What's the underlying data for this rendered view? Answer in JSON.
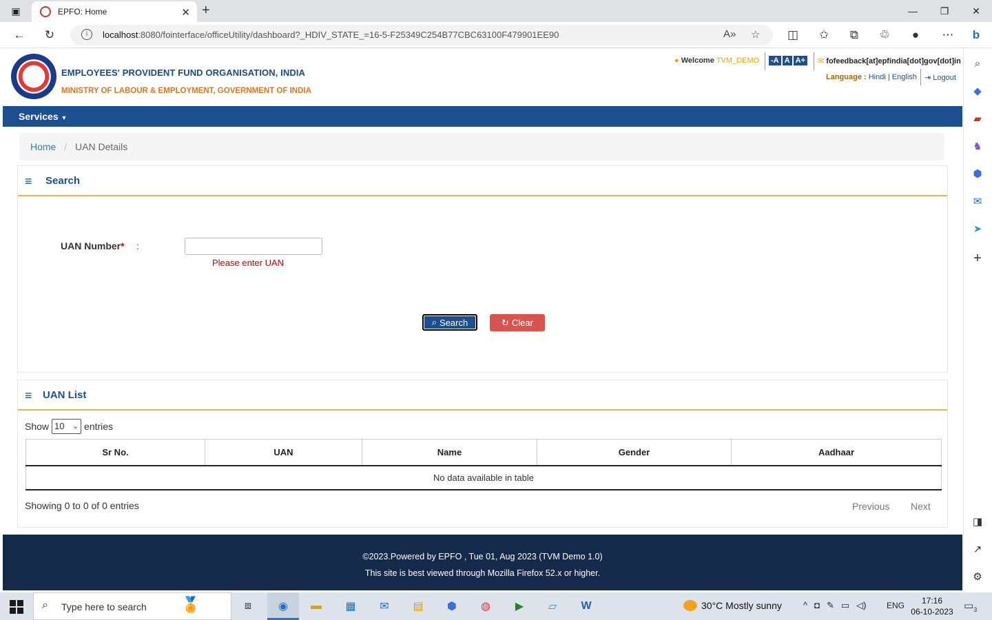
{
  "browser": {
    "tab_title": "EPFO: Home",
    "url_host": "localhost",
    "url_rest": ":8080/fointerface/officeUtility/dashboard?_HDIV_STATE_=16-5-F25349C254B77CBC63100F479901EE90",
    "new_tab": "+",
    "close_tab": "✕"
  },
  "header": {
    "org_name": "EMPLOYEES' PROVIDENT FUND ORGANISATION, INDIA",
    "ministry": "MINISTRY OF LABOUR & EMPLOYMENT, GOVERNMENT OF INDIA",
    "welcome_label": "Welcome",
    "username": "TVM_DEMO",
    "font_small": "-A",
    "font_normal": "A",
    "font_large": "A+",
    "feedback_email": "fofeedback[at]epfindia[dot]gov[dot]in",
    "language_label": "Language :",
    "lang_hindi": "Hindi",
    "lang_sep": "|",
    "lang_english": "English",
    "logout": "Logout"
  },
  "nav": {
    "services": "Services"
  },
  "breadcrumb": {
    "home": "Home",
    "sep": "/",
    "current": "UAN Details"
  },
  "search_panel": {
    "title": "Search",
    "uan_label": "UAN Number",
    "required_mark": "*",
    "colon": ":",
    "uan_value": "",
    "error": "Please enter UAN",
    "search_btn": "Search",
    "clear_btn": "Clear"
  },
  "list_panel": {
    "title": "UAN List",
    "show": "Show",
    "page_size": "10",
    "entries": "entries",
    "columns": [
      "Sr No.",
      "UAN",
      "Name",
      "Gender",
      "Aadhaar"
    ],
    "empty_msg": "No data available in table",
    "info": "Showing 0 to 0 of 0 entries",
    "previous": "Previous",
    "next": "Next"
  },
  "footer": {
    "line1": "©2023.Powered by EPFO , Tue 01, Aug 2023 (TVM Demo 1.0)",
    "line2": "This site is best viewed through Mozilla Firefox 52.x or higher."
  },
  "taskbar": {
    "search_placeholder": "Type here to search",
    "weather": "30°C  Mostly sunny",
    "lang": "ENG",
    "time": "17:16",
    "date": "06-10-2023",
    "notif_count": "3"
  },
  "colors": {
    "brand_blue": "#1c4f90",
    "accent_orange": "#e8731c",
    "danger": "#d9534f",
    "footer_bg": "#152a4a"
  }
}
